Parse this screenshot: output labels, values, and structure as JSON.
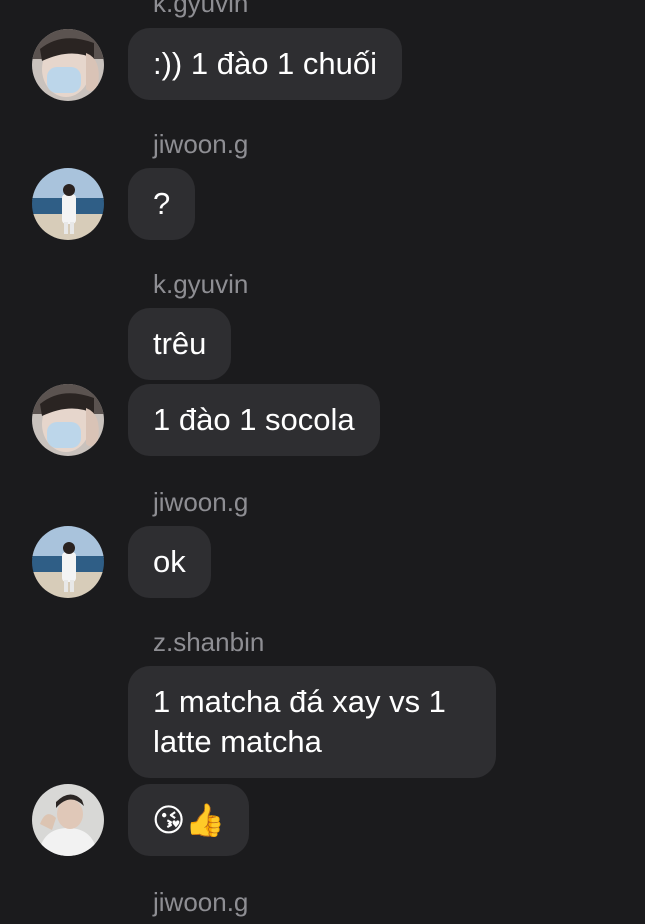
{
  "theme": {
    "background": "#1b1b1d",
    "bubble": "#2e2e31",
    "sender_text": "#8e8e93",
    "message_text": "#ffffff"
  },
  "messages": [
    {
      "sender": "k.gyuvin"
    },
    {
      "text": ":)) 1 đào 1 chuối",
      "avatar": "masked-boy-avatar"
    },
    {
      "sender": "jiwoon.g"
    },
    {
      "text": "?",
      "avatar": "beach-boy-avatar"
    },
    {
      "sender": "k.gyuvin"
    },
    {
      "text": "trêu"
    },
    {
      "text": "1 đào 1 socola",
      "avatar": "masked-boy-avatar"
    },
    {
      "sender": "jiwoon.g"
    },
    {
      "text": "ok",
      "avatar": "beach-boy-avatar"
    },
    {
      "sender": "z.shanbin"
    },
    {
      "text": "1 matcha đá xay vs 1 latte matcha"
    },
    {
      "text": "😘👍",
      "avatar": "boy-portrait-avatar"
    },
    {
      "sender": "jiwoon.g"
    }
  ]
}
